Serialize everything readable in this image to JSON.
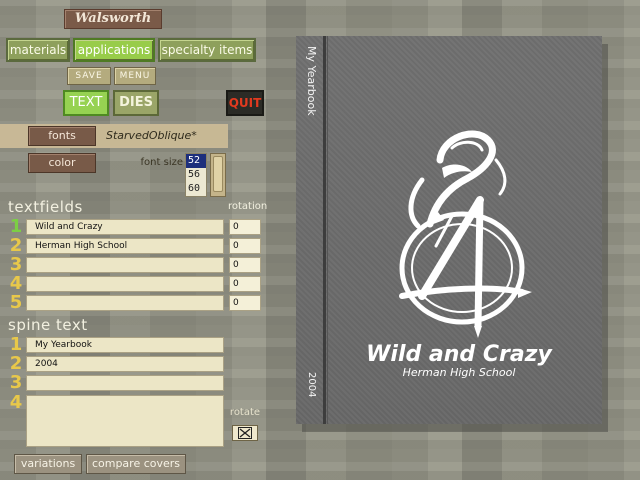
{
  "app": {
    "brand": "Walsworth"
  },
  "nav": {
    "tabs": [
      {
        "label": "materials",
        "active": false
      },
      {
        "label": "applications",
        "active": true
      },
      {
        "label": "specialty items",
        "active": false
      }
    ],
    "save_label": "SAVE",
    "menu_label": "MENU",
    "text_label": "TEXT",
    "dies_label": "DIES",
    "quit_label": "QUIT"
  },
  "font_panel": {
    "fonts_label": "fonts",
    "font_name": "StarvedOblique*",
    "color_label": "color",
    "size_label": "font size",
    "sizes": [
      "52",
      "56",
      "60"
    ],
    "selected_size": "52"
  },
  "textfields": {
    "title": "textfields",
    "rotation_title": "rotation",
    "rows": [
      {
        "num": "1",
        "text": "Wild and Crazy",
        "rotation": "0"
      },
      {
        "num": "2",
        "text": "Herman High School",
        "rotation": "0"
      },
      {
        "num": "3",
        "text": "",
        "rotation": "0"
      },
      {
        "num": "4",
        "text": "",
        "rotation": "0"
      },
      {
        "num": "5",
        "text": "",
        "rotation": "0"
      }
    ]
  },
  "spine": {
    "title": "spine text",
    "rows": [
      {
        "num": "1",
        "text": "My Yearbook"
      },
      {
        "num": "2",
        "text": "2004"
      },
      {
        "num": "3",
        "text": ""
      },
      {
        "num": "4",
        "text": ""
      }
    ],
    "rotate_label": "rotate",
    "rotate_checked": true
  },
  "bottom": {
    "variations_label": "variations",
    "compare_label": "compare covers"
  },
  "cover": {
    "spine_title": "My Yearbook",
    "spine_year": "2004",
    "title": "Wild and Crazy",
    "subtitle": "Herman High School",
    "emblem_icon": "stylized-24-emblem-icon"
  },
  "colors": {
    "tab_active": "#98cc4a",
    "quit_text": "#e23a1f",
    "cover_bg": "#6b6b6b",
    "row_number": "#e8c84a"
  }
}
